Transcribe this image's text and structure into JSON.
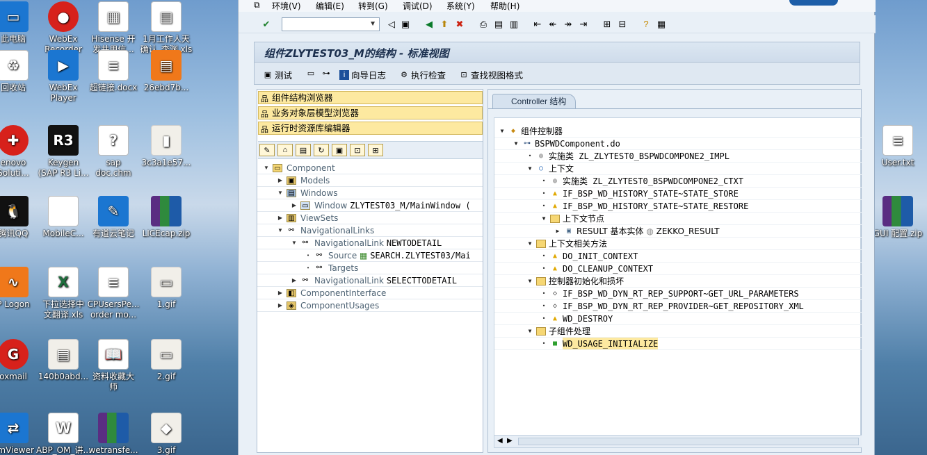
{
  "desktop": {
    "icons": [
      {
        "label": "此电脑",
        "sub": ""
      },
      {
        "label": "WebEx",
        "sub": "Recorder"
      },
      {
        "label": "Hisense 开",
        "sub": "发共用信..."
      },
      {
        "label": "1月工作人天",
        "sub": "确认_李渊.xls"
      },
      {
        "label": "回收站",
        "sub": ""
      },
      {
        "label": "WebEx",
        "sub": "Player"
      },
      {
        "label": "超链接.docx",
        "sub": ""
      },
      {
        "label": "26ebd7b...",
        "sub": ""
      },
      {
        "label": "enovo",
        "sub": "Soluti..."
      },
      {
        "label": "Keygen",
        "sub": "(SAP R3 Li..."
      },
      {
        "label": "sap",
        "sub": "doc.chm"
      },
      {
        "label": "3c3a1e57...",
        "sub": ""
      },
      {
        "label": "腾讯QQ",
        "sub": ""
      },
      {
        "label": "MobileC...",
        "sub": ""
      },
      {
        "label": "有道云笔记",
        "sub": ""
      },
      {
        "label": "LICEcap.zip",
        "sub": ""
      },
      {
        "label": "P Logon",
        "sub": ""
      },
      {
        "label": "下拉选择中",
        "sub": "文翻译.xls"
      },
      {
        "label": "CPUsersPe...",
        "sub": "order mo..."
      },
      {
        "label": "1.gif",
        "sub": ""
      },
      {
        "label": "oxmail",
        "sub": ""
      },
      {
        "label": "140b0abd...",
        "sub": ""
      },
      {
        "label": "资料收藏大",
        "sub": "师"
      },
      {
        "label": "2.gif",
        "sub": ""
      },
      {
        "label": "amViewer",
        "sub": ""
      },
      {
        "label": "ABP_OM_讲...",
        "sub": ""
      },
      {
        "label": "wetransfe...",
        "sub": ""
      },
      {
        "label": "3.gif",
        "sub": ""
      },
      {
        "label": "User.txt",
        "sub": ""
      },
      {
        "label": "GUI 配置.zip",
        "sub": ""
      }
    ]
  },
  "menubar": {
    "items": [
      "环境(V)",
      "编辑(E)",
      "转到(G)",
      "调试(D)",
      "系统(Y)",
      "帮助(H)"
    ]
  },
  "toolbar": {
    "command_field": ""
  },
  "title": "组件ZLYTEST03_M的结构 - 标准视图",
  "app_toolbar": {
    "test": "测试",
    "wizard_log": "向导日志",
    "run_check": "执行检查",
    "find_view_format": "查找视图格式"
  },
  "left_nav": {
    "buttons": [
      "组件结构浏览器",
      "业务对象层模型浏览器",
      "运行时资源库编辑器"
    ]
  },
  "left_tree": [
    {
      "label": "Component",
      "value": "",
      "level": 0,
      "expanded": true,
      "icon": "folder"
    },
    {
      "label": "Models",
      "value": "",
      "level": 1,
      "expanded": false,
      "icon": "models"
    },
    {
      "label": "Windows",
      "value": "",
      "level": 1,
      "expanded": true,
      "icon": "windows"
    },
    {
      "label": "Window",
      "value": "ZLYTEST03_M/MainWindow (",
      "level": 2,
      "expanded": false,
      "icon": "window"
    },
    {
      "label": "ViewSets",
      "value": "",
      "level": 1,
      "expanded": false,
      "icon": "viewsets"
    },
    {
      "label": "NavigationalLinks",
      "value": "",
      "level": 1,
      "expanded": true,
      "icon": "link"
    },
    {
      "label": "NavigationalLink",
      "value": "NEWTODETAIL",
      "level": 2,
      "expanded": true,
      "icon": "link"
    },
    {
      "label": "Source",
      "value": "SEARCH.ZLYTEST03/Mai",
      "level": 3,
      "expanded": false,
      "icon": "link"
    },
    {
      "label": "Targets",
      "value": "",
      "level": 3,
      "expanded": false,
      "icon": "link"
    },
    {
      "label": "NavigationalLink",
      "value": "SELECTTODETAIL",
      "level": 2,
      "expanded": false,
      "icon": "link"
    },
    {
      "label": "ComponentInterface",
      "value": "",
      "level": 1,
      "expanded": false,
      "icon": "interface"
    },
    {
      "label": "ComponentUsages",
      "value": "",
      "level": 1,
      "expanded": false,
      "icon": "usages"
    }
  ],
  "right_tab": "Controller 结构",
  "right_tree": [
    {
      "label": "组件控制器",
      "level": 0,
      "exp": "open",
      "icon": "ctrl"
    },
    {
      "label": "BSPWDComponent.do",
      "level": 1,
      "exp": "open",
      "icon": "bsp"
    },
    {
      "label": "实施类 ZL_ZLYTEST0_BSPWDCOMPONE2_IMPL",
      "level": 2,
      "exp": "leaf",
      "icon": "class"
    },
    {
      "label": "上下文",
      "level": 2,
      "exp": "open",
      "icon": "context"
    },
    {
      "label": "实施类 ZL_ZLYTEST0_BSPWDCOMPONE2_CTXT",
      "level": 3,
      "exp": "leaf",
      "icon": "class"
    },
    {
      "label": "IF_BSP_WD_HISTORY_STATE~STATE_STORE",
      "level": 3,
      "exp": "leaf",
      "icon": "warn"
    },
    {
      "label": "IF_BSP_WD_HISTORY_STATE~STATE_RESTORE",
      "level": 3,
      "exp": "leaf",
      "icon": "warn"
    },
    {
      "label": "上下文节点",
      "level": 3,
      "exp": "open",
      "icon": "folder"
    },
    {
      "label": "RESULT 基本实体 ",
      "extra": "ZEKKO_RESULT",
      "level": 4,
      "exp": "closed",
      "icon": "node"
    },
    {
      "label": "上下文相关方法",
      "level": 2,
      "exp": "open",
      "icon": "folder"
    },
    {
      "label": "DO_INIT_CONTEXT",
      "level": 3,
      "exp": "leaf",
      "icon": "warn"
    },
    {
      "label": "DO_CLEANUP_CONTEXT",
      "level": 3,
      "exp": "leaf",
      "icon": "warn"
    },
    {
      "label": "控制器初始化和损坏",
      "level": 2,
      "exp": "open",
      "icon": "folder"
    },
    {
      "label": "IF_BSP_WD_DYN_RT_REP_SUPPORT~GET_URL_PARAMETERS",
      "level": 3,
      "exp": "leaf",
      "icon": "diamond"
    },
    {
      "label": "IF_BSP_WD_DYN_RT_REP_PROVIDER~GET_REPOSITORY_XML",
      "level": 3,
      "exp": "leaf",
      "icon": "diamond"
    },
    {
      "label": "WD_DESTROY",
      "level": 3,
      "exp": "leaf",
      "icon": "warn"
    },
    {
      "label": "子组件处理",
      "level": 2,
      "exp": "open",
      "icon": "folder"
    },
    {
      "label": "WD_USAGE_INITIALIZE",
      "level": 3,
      "exp": "leaf",
      "icon": "green",
      "selected": true
    }
  ]
}
